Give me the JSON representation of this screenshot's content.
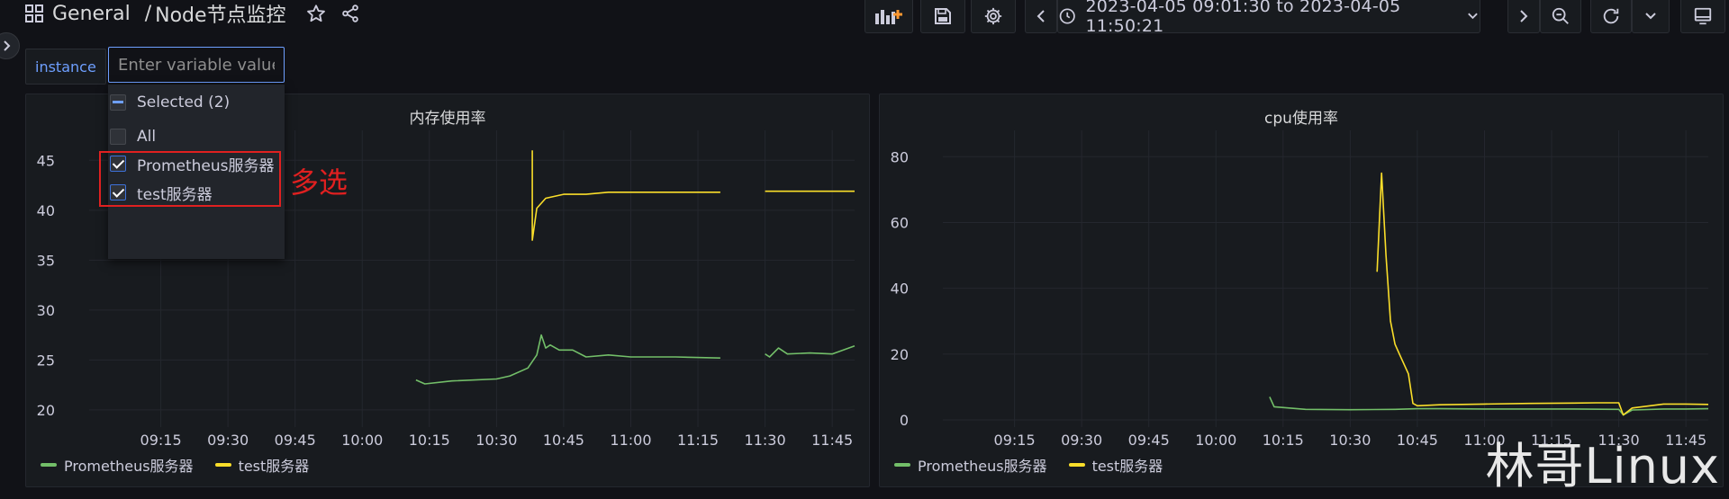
{
  "header": {
    "folder": "General",
    "separator": "/",
    "dashboard_title": "Node节点监控",
    "time_range": "2023-04-05 09:01:30 to 2023-04-05 11:50:21"
  },
  "variables": {
    "label": "instance",
    "placeholder": "Enter variable value",
    "options": [
      {
        "label": "Selected (2)",
        "state": "mixed"
      },
      {
        "label": "All",
        "state": "unchecked"
      },
      {
        "label": "Prometheus服务器",
        "state": "checked"
      },
      {
        "label": "test服务器",
        "state": "checked"
      }
    ]
  },
  "annotation": {
    "text": "多选",
    "color": "#e02020"
  },
  "colors": {
    "series_prometheus": "#73bf69",
    "series_test": "#fade2a",
    "accent": "#6e9fff"
  },
  "panels": [
    {
      "title": "内存使用率",
      "legend": [
        "Prometheus服务器",
        "test服务器"
      ],
      "yticks": [
        "45",
        "40",
        "35",
        "30",
        "25",
        "20"
      ],
      "xticks": [
        "09:15",
        "09:30",
        "09:45",
        "10:00",
        "10:15",
        "10:30",
        "10:45",
        "11:00",
        "11:15",
        "11:30",
        "11:45"
      ]
    },
    {
      "title": "cpu使用率",
      "legend": [
        "Prometheus服务器",
        "test服务器"
      ],
      "yticks": [
        "80",
        "60",
        "40",
        "20",
        "0"
      ],
      "xticks": [
        "09:15",
        "09:30",
        "09:45",
        "10:00",
        "10:15",
        "10:30",
        "10:45",
        "11:00",
        "11:15",
        "11:30",
        "11:45"
      ]
    }
  ],
  "chart_data": [
    {
      "type": "line",
      "title": "内存使用率",
      "ylim": [
        19,
        48
      ],
      "xrange": [
        "09:01",
        "11:50"
      ],
      "series": [
        {
          "name": "Prometheus服务器",
          "x": [
            "10:12",
            "10:14",
            "10:20",
            "10:30",
            "10:33",
            "10:37",
            "10:39",
            "10:40",
            "10:41",
            "10:42",
            "10:44",
            "10:47",
            "10:50",
            "10:55",
            "11:00",
            "11:10",
            "11:20",
            "11:25",
            "11:30",
            "11:31",
            "11:33",
            "11:35",
            "11:40",
            "11:45",
            "11:50"
          ],
          "y": [
            23,
            22.6,
            22.9,
            23.1,
            23.4,
            24.2,
            25.5,
            27.5,
            26.2,
            26.5,
            26.0,
            26.0,
            25.3,
            25.5,
            25.3,
            25.3,
            25.2,
            null,
            25.6,
            25.3,
            26.2,
            25.6,
            25.7,
            25.6,
            26.4
          ]
        },
        {
          "name": "test服务器",
          "x": [
            "10:38",
            "10:38",
            "10:39",
            "10:41",
            "10:45",
            "10:50",
            "10:55",
            "11:00",
            "11:10",
            "11:20",
            "11:25",
            "11:30",
            "11:35",
            "11:40",
            "11:45",
            "11:50"
          ],
          "y": [
            46,
            37,
            40.2,
            41.2,
            41.6,
            41.6,
            41.8,
            41.8,
            41.8,
            41.8,
            null,
            41.9,
            41.9,
            41.9,
            41.9,
            41.9
          ]
        }
      ]
    },
    {
      "type": "line",
      "title": "cpu使用率",
      "ylim": [
        0,
        88
      ],
      "xrange": [
        "09:01",
        "11:50"
      ],
      "series": [
        {
          "name": "Prometheus服务器",
          "x": [
            "10:12",
            "10:13",
            "10:20",
            "10:30",
            "10:40",
            "10:45",
            "10:50",
            "11:00",
            "11:10",
            "11:20",
            "11:30",
            "11:31",
            "11:33",
            "11:40",
            "11:45",
            "11:50"
          ],
          "y": [
            7,
            4,
            3.2,
            3.1,
            3.2,
            3.4,
            3.4,
            3.3,
            3.3,
            3.3,
            3.2,
            1.5,
            3,
            3.3,
            3.3,
            3.4
          ]
        },
        {
          "name": "test服务器",
          "x": [
            "10:36",
            "10:37",
            "10:38",
            "10:39",
            "10:40",
            "10:41",
            "10:43",
            "10:44",
            "10:45",
            "10:50",
            "11:00",
            "11:10",
            "11:20",
            "11:25",
            "11:30",
            "11:31",
            "11:33",
            "11:40",
            "11:45",
            "11:50"
          ],
          "y": [
            45,
            75,
            50,
            30,
            23,
            20,
            14,
            5,
            4.3,
            4.6,
            4.8,
            5,
            5.1,
            5.2,
            5.2,
            1.5,
            3.6,
            4.8,
            4.8,
            4.7
          ]
        }
      ]
    }
  ]
}
